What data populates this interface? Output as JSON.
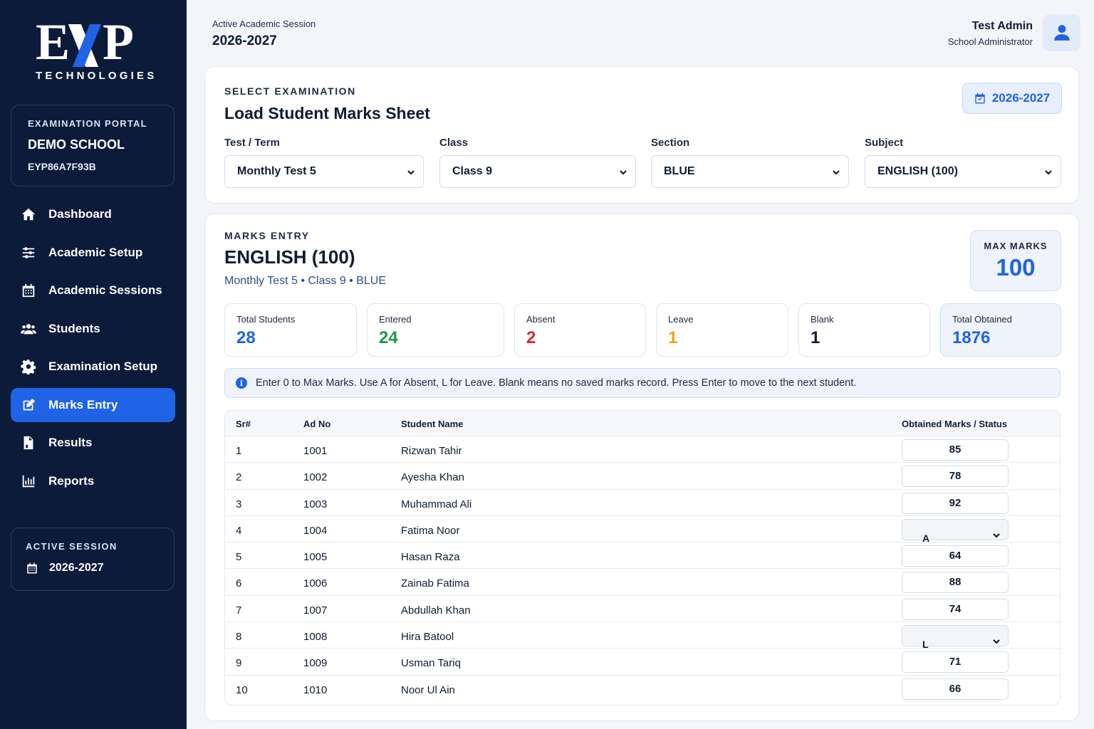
{
  "brand": {
    "logo_left": "E",
    "logo_right": "P",
    "subtitle": "TECHNOLOGIES"
  },
  "portal": {
    "label": "EXAMINATION PORTAL",
    "school": "DEMO SCHOOL",
    "code": "EYP86A7F93B"
  },
  "nav": [
    {
      "label": "Dashboard",
      "icon": "home-icon",
      "active": false
    },
    {
      "label": "Academic Setup",
      "icon": "sliders-icon",
      "active": false
    },
    {
      "label": "Academic Sessions",
      "icon": "calendar-icon",
      "active": false
    },
    {
      "label": "Students",
      "icon": "users-icon",
      "active": false
    },
    {
      "label": "Examination Setup",
      "icon": "gear-icon",
      "active": false
    },
    {
      "label": "Marks Entry",
      "icon": "edit-icon",
      "active": true
    },
    {
      "label": "Results",
      "icon": "document-icon",
      "active": false
    },
    {
      "label": "Reports",
      "icon": "bar-chart-icon",
      "active": false
    }
  ],
  "sidebar_session": {
    "label": "ACTIVE SESSION",
    "value": "2026-2027"
  },
  "header": {
    "subtitle": "Active Academic Session",
    "session": "2026-2027",
    "user_name": "Test Admin",
    "user_role": "School Administrator"
  },
  "select_card": {
    "eyebrow": "SELECT EXAMINATION",
    "title": "Load Student Marks Sheet",
    "year_pill": "2026-2027",
    "fields": [
      {
        "label": "Test / Term",
        "value": "Monthly Test 5"
      },
      {
        "label": "Class",
        "value": "Class 9"
      },
      {
        "label": "Section",
        "value": "BLUE"
      },
      {
        "label": "Subject",
        "value": "ENGLISH (100)"
      }
    ]
  },
  "marks_card": {
    "eyebrow": "MARKS ENTRY",
    "title": "ENGLISH (100)",
    "meta": "Monthly Test 5 • Class 9 • BLUE",
    "max_label": "MAX MARKS",
    "max_value": "100",
    "stats": [
      {
        "label": "Total Students",
        "value": "28",
        "color": "#1f63e6"
      },
      {
        "label": "Entered",
        "value": "24",
        "color": "#1a9a4a"
      },
      {
        "label": "Absent",
        "value": "2",
        "color": "#d9262c"
      },
      {
        "label": "Leave",
        "value": "1",
        "color": "#f0a020"
      },
      {
        "label": "Blank",
        "value": "1",
        "color": "#0f1c33"
      },
      {
        "label": "Total Obtained",
        "value": "1876",
        "color": "#1f63e6"
      }
    ],
    "info": "Enter 0 to Max Marks. Use A for Absent, L for Leave. Blank means no saved marks record. Press Enter to move to the next student.",
    "columns": {
      "sr": "Sr#",
      "ad": "Ad No",
      "name": "Student Name",
      "marks": "Obtained Marks / Status"
    },
    "rows": [
      {
        "sr": "1",
        "ad": "1001",
        "name": "Rizwan Tahir",
        "marks": "85",
        "kind": "input"
      },
      {
        "sr": "2",
        "ad": "1002",
        "name": "Ayesha Khan",
        "marks": "78",
        "kind": "input"
      },
      {
        "sr": "3",
        "ad": "1003",
        "name": "Muhammad Ali",
        "marks": "92",
        "kind": "input"
      },
      {
        "sr": "4",
        "ad": "1004",
        "name": "Fatima Noor",
        "marks": "A",
        "kind": "select"
      },
      {
        "sr": "5",
        "ad": "1005",
        "name": "Hasan Raza",
        "marks": "64",
        "kind": "input"
      },
      {
        "sr": "6",
        "ad": "1006",
        "name": "Zainab Fatima",
        "marks": "88",
        "kind": "input"
      },
      {
        "sr": "7",
        "ad": "1007",
        "name": "Abdullah Khan",
        "marks": "74",
        "kind": "input"
      },
      {
        "sr": "8",
        "ad": "1008",
        "name": "Hira Batool",
        "marks": "L",
        "kind": "select"
      },
      {
        "sr": "9",
        "ad": "1009",
        "name": "Usman Tariq",
        "marks": "71",
        "kind": "input"
      },
      {
        "sr": "10",
        "ad": "1010",
        "name": "Noor Ul Ain",
        "marks": "66",
        "kind": "input"
      }
    ]
  }
}
